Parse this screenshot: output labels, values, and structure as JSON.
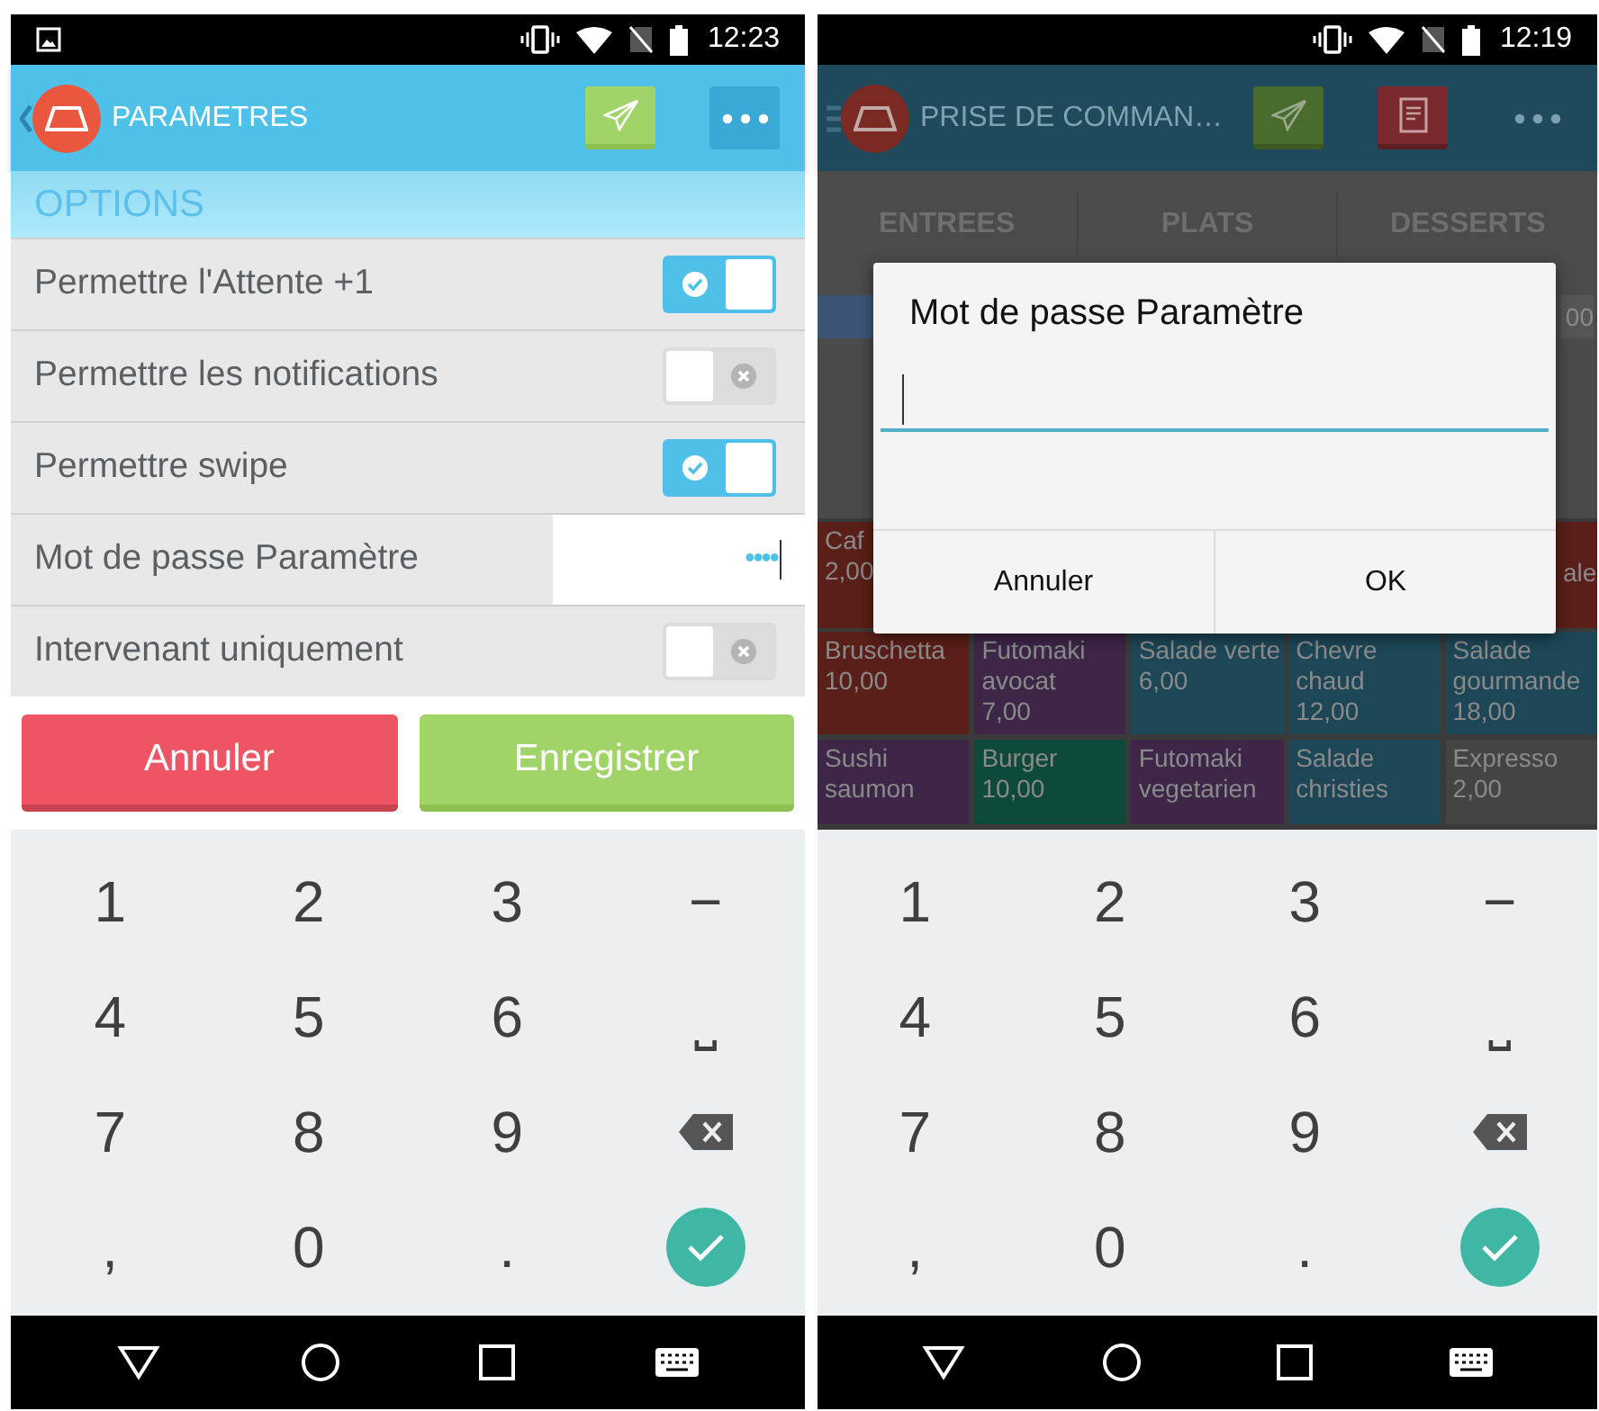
{
  "screens": [
    {
      "status_bar": {
        "time": "12:23"
      },
      "app_bar": {
        "title": "PARAMETRES"
      },
      "section": "OPTIONS",
      "settings": [
        {
          "kind": "toggle",
          "label": "Permettre l'Attente +1",
          "on": true
        },
        {
          "kind": "toggle",
          "label": "Permettre les notifications",
          "on": false
        },
        {
          "kind": "toggle",
          "label": "Permettre swipe",
          "on": true
        },
        {
          "kind": "password",
          "label": "Mot de passe Paramètre",
          "value": "••••"
        },
        {
          "kind": "toggle",
          "label": "Intervenant uniquement",
          "on": false
        }
      ],
      "buttons": [
        {
          "kind": "cancel",
          "label": "Annuler"
        },
        {
          "kind": "save",
          "label": "Enregistrer"
        }
      ],
      "keyboard": {
        "keys": [
          {
            "kind": "char",
            "label": "1"
          },
          {
            "kind": "char",
            "label": "2"
          },
          {
            "kind": "char",
            "label": "3"
          },
          {
            "kind": "char",
            "label": "−"
          },
          {
            "kind": "char",
            "label": "4"
          },
          {
            "kind": "char",
            "label": "5"
          },
          {
            "kind": "char",
            "label": "6"
          },
          {
            "kind": "char",
            "label": "⎵"
          },
          {
            "kind": "char",
            "label": "7"
          },
          {
            "kind": "char",
            "label": "8"
          },
          {
            "kind": "char",
            "label": "9"
          },
          {
            "kind": "backspace"
          },
          {
            "kind": "char",
            "label": ","
          },
          {
            "kind": "char",
            "label": "0"
          },
          {
            "kind": "char",
            "label": "."
          },
          {
            "kind": "enter"
          }
        ]
      }
    },
    {
      "status_bar": {
        "time": "12:19"
      },
      "app_bar": {
        "title": "PRISE DE COMMAN…"
      },
      "tabs": [
        {
          "label": "ENTREES",
          "selected": false
        },
        {
          "label": "PLATS",
          "selected": false
        },
        {
          "label": "DESSERTS",
          "selected": false
        }
      ],
      "order_bar": {
        "total": "00"
      },
      "tiles_top": [
        {
          "lines": [
            "Caf",
            "2,00"
          ],
          "color": "#5a1f18"
        },
        {
          "lines": [
            "ale"
          ],
          "color": "#5a1f18"
        }
      ],
      "tiles": [
        [
          {
            "lines": [
              "Bruschetta",
              "10,00"
            ],
            "color": "#5a1f18"
          },
          {
            "lines": [
              "Futomaki",
              "avocat",
              "7,00"
            ],
            "color": "#3d2647"
          },
          {
            "lines": [
              "Salade verte",
              "6,00"
            ],
            "color": "#1d4656"
          },
          {
            "lines": [
              "Chevre",
              "chaud",
              "12,00"
            ],
            "color": "#1d4656"
          },
          {
            "lines": [
              "Salade",
              "gourmande",
              "18,00"
            ],
            "color": "#1d4656"
          }
        ],
        [
          {
            "lines": [
              "Sushi",
              "saumon"
            ],
            "color": "#3d2647"
          },
          {
            "lines": [
              "Burger",
              "10,00"
            ],
            "color": "#0e4a3b"
          },
          {
            "lines": [
              "Futomaki",
              "vegetarien"
            ],
            "color": "#3d2647"
          },
          {
            "lines": [
              "Salade",
              "christies"
            ],
            "color": "#1d4656"
          },
          {
            "lines": [
              "Expresso",
              "2,00"
            ],
            "color": "#444444"
          }
        ]
      ],
      "dialog": {
        "title": "Mot de passe Paramètre",
        "buttons": [
          "Annuler",
          "OK"
        ]
      },
      "keyboard": {
        "keys": [
          {
            "kind": "char",
            "label": "1"
          },
          {
            "kind": "char",
            "label": "2"
          },
          {
            "kind": "char",
            "label": "3"
          },
          {
            "kind": "char",
            "label": "−"
          },
          {
            "kind": "char",
            "label": "4"
          },
          {
            "kind": "char",
            "label": "5"
          },
          {
            "kind": "char",
            "label": "6"
          },
          {
            "kind": "char",
            "label": "⎵"
          },
          {
            "kind": "char",
            "label": "7"
          },
          {
            "kind": "char",
            "label": "8"
          },
          {
            "kind": "char",
            "label": "9"
          },
          {
            "kind": "backspace"
          },
          {
            "kind": "char",
            "label": ","
          },
          {
            "kind": "char",
            "label": "0"
          },
          {
            "kind": "char",
            "label": "."
          },
          {
            "kind": "enter"
          }
        ]
      }
    }
  ]
}
